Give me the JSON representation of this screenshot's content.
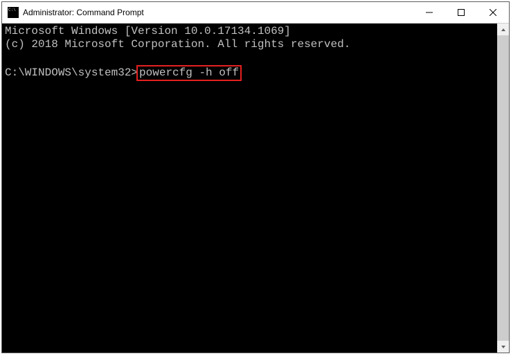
{
  "window": {
    "title": "Administrator: Command Prompt"
  },
  "terminal": {
    "line1": "Microsoft Windows [Version 10.0.17134.1069]",
    "line2": "(c) 2018 Microsoft Corporation. All rights reserved.",
    "prompt": "C:\\WINDOWS\\system32>",
    "command": "powercfg -h off"
  },
  "colors": {
    "terminal_bg": "#000000",
    "terminal_fg": "#c0c0c0",
    "highlight": "#e52020"
  }
}
